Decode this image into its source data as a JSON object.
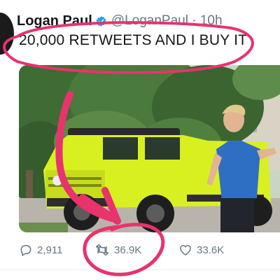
{
  "tweet": {
    "author_name": "Logan Paul",
    "handle_time": "@LoganPaul · 10h",
    "text": "20,000 RETWEETS AND I BUY IT"
  },
  "actions": {
    "replies": "2,911",
    "retweets": "36.9K",
    "likes": "33.6K"
  },
  "colors": {
    "annotation": "#e8336d",
    "verified": "#1da1f2",
    "meta_text": "#657786",
    "truck": "#d9f020"
  },
  "icons": [
    "verified-badge-icon",
    "reply-icon",
    "retweet-icon",
    "like-icon"
  ]
}
